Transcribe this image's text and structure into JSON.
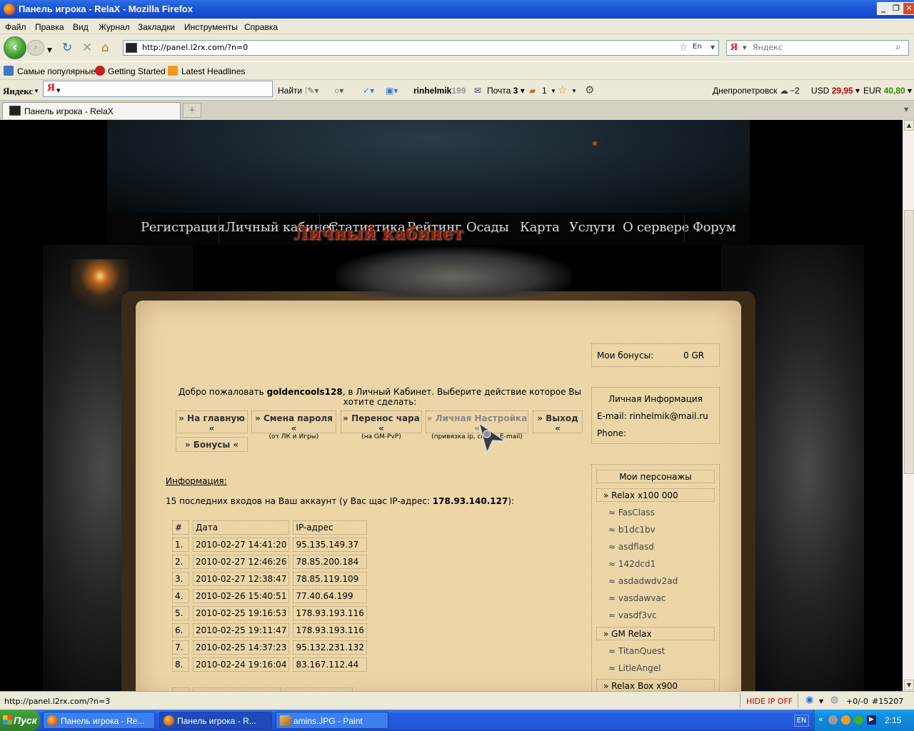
{
  "window": {
    "title": "Панель игрока - RelaX - Mozilla Firefox"
  },
  "menu": [
    "Файл",
    "Правка",
    "Вид",
    "Журнал",
    "Закладки",
    "Инструменты",
    "Справка"
  ],
  "nav": {
    "url": "http://panel.l2rx.com/?n=0",
    "search_placeholder": "Яндекс",
    "lang_badge": "En"
  },
  "bookmarks": [
    "Самые популярные",
    "Getting Started",
    "Latest Headlines"
  ],
  "yandex_bar": {
    "brand": "Яндекс",
    "find": "Найти",
    "user": "rinhelmik",
    "user_suffix": "199",
    "mail_label": "Почта",
    "mail_count": "3",
    "count2": "1",
    "city": "Днепропетровск",
    "temp": "−2",
    "usd_label": "USD",
    "usd": "29,95",
    "eur_label": "EUR",
    "eur": "40,80"
  },
  "tab": {
    "title": "Панель игрока - RelaX"
  },
  "site_nav": [
    "Регистрация",
    "Личный кабинет",
    "Статистика",
    "Рейтинг",
    "Осады",
    "Карта",
    "Услуги",
    "О сервере",
    "Форум"
  ],
  "page": {
    "title": "Личный кабинет",
    "welcome_pre": "Добро пожаловать ",
    "username": "goldencools128",
    "welcome_post": ", в Личный Кабинет. Выберите действие которое Вы хотите сделать:",
    "buttons": [
      {
        "label": "» На главную «",
        "sub": ""
      },
      {
        "label": "» Смена пароля «",
        "sub": "(от ЛК и Игры)"
      },
      {
        "label": "» Перенос чара «",
        "sub": "(на GM-PvP)"
      },
      {
        "label": "» Личная Настройка «",
        "sub": "(привязка ip, смена E-mail)"
      },
      {
        "label": "» Выход «",
        "sub": ""
      },
      {
        "label": "» Бонусы «",
        "sub": ""
      }
    ],
    "info_title": "Информация:",
    "logins_pre": "15 последних входов на Ваш аккаунт (у Вас щас IP-адрес: ",
    "current_ip": "178.93.140.127",
    "logins_post": "):",
    "table_headers": [
      "#",
      "Дата",
      "IP-адрес"
    ],
    "rows": [
      [
        "1.",
        "2010-02-27 14:41:20",
        "95.135.149.37"
      ],
      [
        "2.",
        "2010-02-27 12:46:26",
        "78.85.200.184"
      ],
      [
        "3.",
        "2010-02-27 12:38:47",
        "78.85.119.109"
      ],
      [
        "4.",
        "2010-02-26 15:40:51",
        "77.40.64.199"
      ],
      [
        "5.",
        "2010-02-25 19:16:53",
        "178.93.193.116"
      ],
      [
        "6.",
        "2010-02-25 19:11:47",
        "178.93.193.116"
      ],
      [
        "7.",
        "2010-02-25 14:37:23",
        "95.132.231.132"
      ],
      [
        "8.",
        "2010-02-24 19:16:04",
        "83.167.112.44"
      ]
    ]
  },
  "sidebar": {
    "bonuses_label": "Мои бонусы:",
    "bonuses_value": "0 GR",
    "personal_title": "Личная Информация",
    "email_label": "E-mail:",
    "email": "rinhelmik@mail.ru",
    "phone_label": "Phone:",
    "chars_title": "Мои персонажы",
    "servers": [
      {
        "name": "» Relax x100 000",
        "chars": [
          "≈ FasClass",
          "≈ b1dc1bv",
          "≈ asdflasd",
          "≈ 142dcd1",
          "≈ asdadwdv2ad",
          "≈ vasdawvac",
          "≈ vasdf3vc"
        ]
      },
      {
        "name": "» GM Relax",
        "chars": [
          "≈ TitanQuest",
          "≈ LitleAngel"
        ]
      },
      {
        "name": "» Relax Box x900",
        "chars": []
      }
    ]
  },
  "status": {
    "url": "http://panel.l2rx.com/?n=3",
    "hide_ip": "HIDE IP OFF",
    "counter": "+0/-0",
    "id": "#15207"
  },
  "taskbar": {
    "start": "Пуск",
    "items": [
      "Панель игрока - Re...",
      "Панель игрока - R...",
      "amins.JPG - Paint"
    ],
    "lang": "EN",
    "clock": "2:15"
  },
  "colors": {
    "title_red": "#8a1e12",
    "parchment": "#ecd6a8",
    "usd": "#c00000",
    "eur": "#2e8b00",
    "hide_ip": "#cc0000"
  }
}
